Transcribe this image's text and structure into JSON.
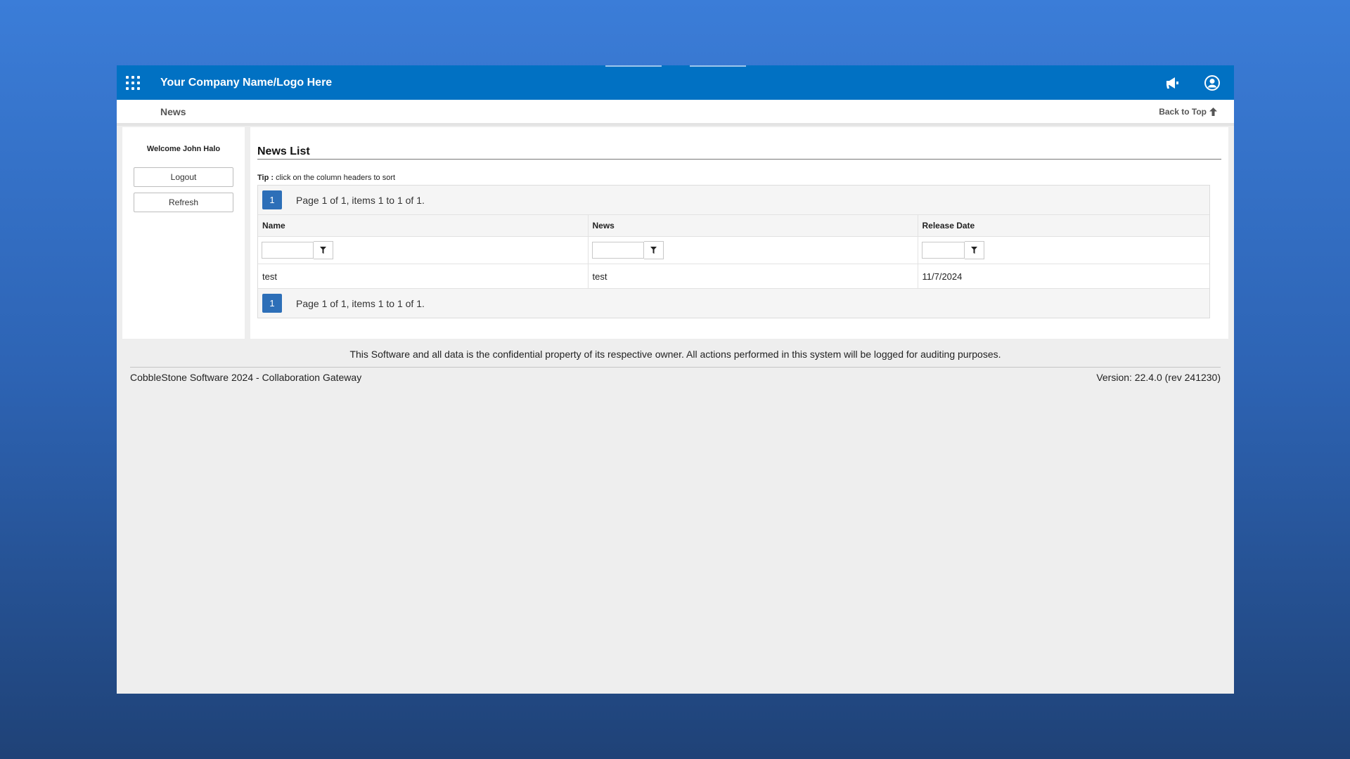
{
  "header": {
    "brand": "Your Company Name/Logo Here"
  },
  "subbar": {
    "breadcrumb": "News",
    "back_to_top": "Back to Top"
  },
  "sidebar": {
    "welcome": "Welcome John Halo",
    "logout_label": "Logout",
    "refresh_label": "Refresh"
  },
  "main": {
    "title": "News List",
    "tip_label": "Tip :",
    "tip_text": " click on the column headers to sort",
    "pager": {
      "page": "1",
      "info": "Page 1 of 1, items 1 to 1 of 1."
    },
    "columns": [
      "Name",
      "News",
      "Release Date"
    ],
    "rows": [
      [
        "test",
        "test",
        "11/7/2024"
      ]
    ]
  },
  "footer": {
    "notice": "This Software and all data is the confidential property of its respective owner. All actions performed in this system will be logged for auditing purposes.",
    "left": "CobbleStone Software 2024 - Collaboration Gateway",
    "right": "Version: 22.4.0 (rev 241230)"
  },
  "colors": {
    "header_bg": "#0171c3",
    "pager_active": "#2d6fb8"
  }
}
